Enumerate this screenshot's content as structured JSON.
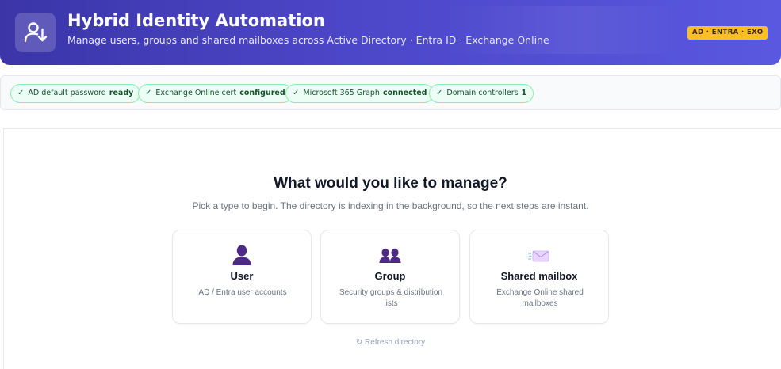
{
  "header": {
    "title": "Hybrid Identity Automation",
    "subtitle": "Manage users, groups and shared mailboxes across Active Directory · Entra ID · Exchange Online",
    "env_badge": "AD · ENTRA · EXO",
    "logo_icon": "user-sync-icon"
  },
  "status": [
    {
      "label": "AD default password",
      "value": "ready"
    },
    {
      "label": "Exchange Online cert",
      "value": "configured"
    },
    {
      "label": "Microsoft 365 Graph",
      "value": "connected"
    },
    {
      "label": "Domain controllers",
      "value": "1"
    }
  ],
  "status_check_glyph": "✓",
  "main": {
    "heading": "What would you like to manage?",
    "subheading": "Pick a type to begin. The directory is indexing in the background, so the next steps are instant.",
    "cards": [
      {
        "icon": "user-icon",
        "title": "User",
        "description": "AD / Entra user accounts"
      },
      {
        "icon": "group-icon",
        "title": "Group",
        "description": "Security groups & distribution lists"
      },
      {
        "icon": "mailbox-icon",
        "title": "Shared mailbox",
        "description": "Exchange Online shared mailboxes"
      }
    ],
    "refresh_label": "↻ Refresh directory"
  },
  "colors": {
    "header_start": "#3b35a8",
    "header_end": "#5a58e0",
    "badge": "#fbbf24",
    "pill_bg": "#ecfdf5",
    "pill_border": "#86efac",
    "icon_purple": "#4c2a85"
  }
}
